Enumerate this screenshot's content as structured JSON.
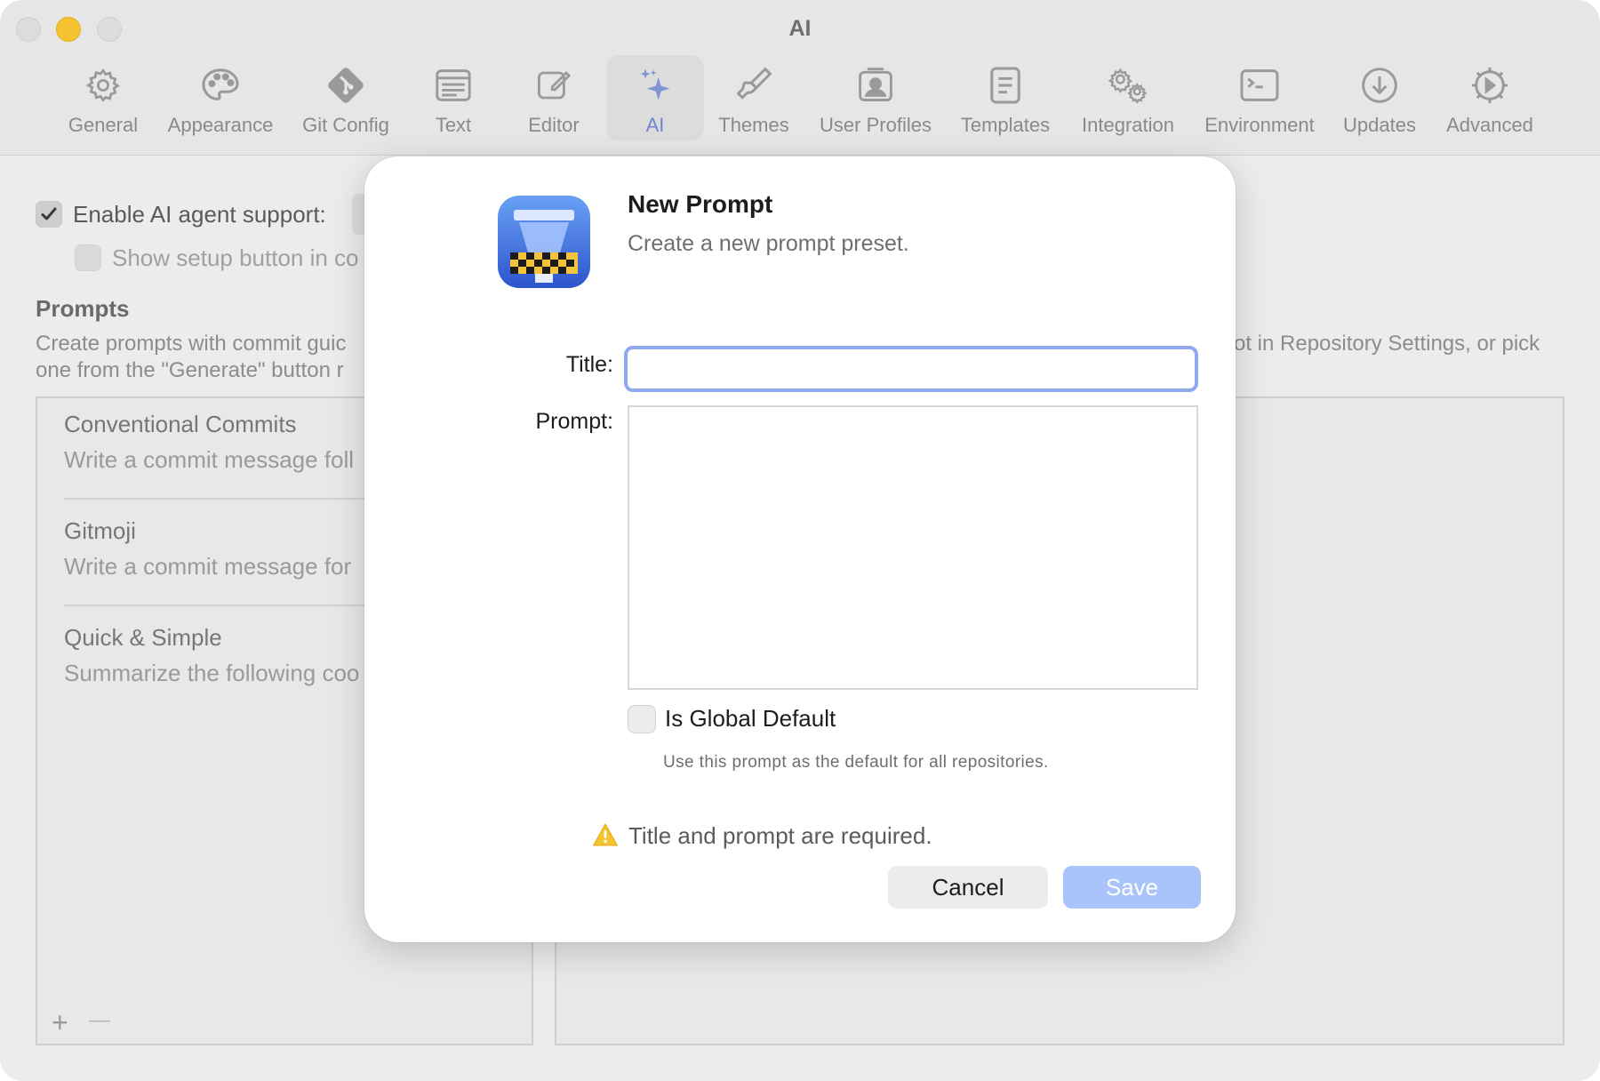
{
  "window": {
    "title": "AI"
  },
  "toolbar": {
    "items": [
      {
        "label": "General",
        "icon": "gear-icon"
      },
      {
        "label": "Appearance",
        "icon": "palette-icon"
      },
      {
        "label": "Git Config",
        "icon": "git-icon"
      },
      {
        "label": "Text",
        "icon": "text-window-icon"
      },
      {
        "label": "Editor",
        "icon": "pencil-square-icon"
      },
      {
        "label": "AI",
        "icon": "sparkles-icon"
      },
      {
        "label": "Themes",
        "icon": "paintbrush-icon"
      },
      {
        "label": "User Profiles",
        "icon": "person-card-icon"
      },
      {
        "label": "Templates",
        "icon": "document-icon"
      },
      {
        "label": "Integration",
        "icon": "gears-icon"
      },
      {
        "label": "Environment",
        "icon": "terminal-icon"
      },
      {
        "label": "Updates",
        "icon": "download-circle-icon"
      },
      {
        "label": "Advanced",
        "icon": "gear-badge-icon"
      }
    ],
    "active": "AI"
  },
  "settings": {
    "enable_ai_label": "Enable AI agent support:",
    "show_setup_label": "Show setup button in co",
    "prompts_heading": "Prompts",
    "prompts_desc_line1_left": "Create prompts with commit guic",
    "prompts_desc_line1_right": "ot in Repository Settings, or pick",
    "prompts_desc_line2_left": "one from the \"Generate\" button r"
  },
  "prompts_list": [
    {
      "title": "Conventional Commits",
      "subtitle": "Write a commit message foll"
    },
    {
      "title": "Gitmoji",
      "subtitle": "Write a commit message for"
    },
    {
      "title": "Quick & Simple",
      "subtitle": "Summarize the following coo"
    }
  ],
  "list_controls": {
    "add": "+",
    "remove": "—"
  },
  "modal": {
    "title": "New Prompt",
    "subtitle": "Create a new prompt preset.",
    "title_label": "Title:",
    "title_value": "",
    "prompt_label": "Prompt:",
    "prompt_value": "",
    "global_default_label": "Is Global Default",
    "global_default_help": "Use this prompt as the default for all repositories.",
    "warning": "Title and prompt are required.",
    "cancel_label": "Cancel",
    "save_label": "Save"
  },
  "colors": {
    "accent": "#8fa8ee",
    "save_disabled": "#a9c3fb",
    "warning": "#f5c330",
    "active_tab": "#6f86c8"
  }
}
